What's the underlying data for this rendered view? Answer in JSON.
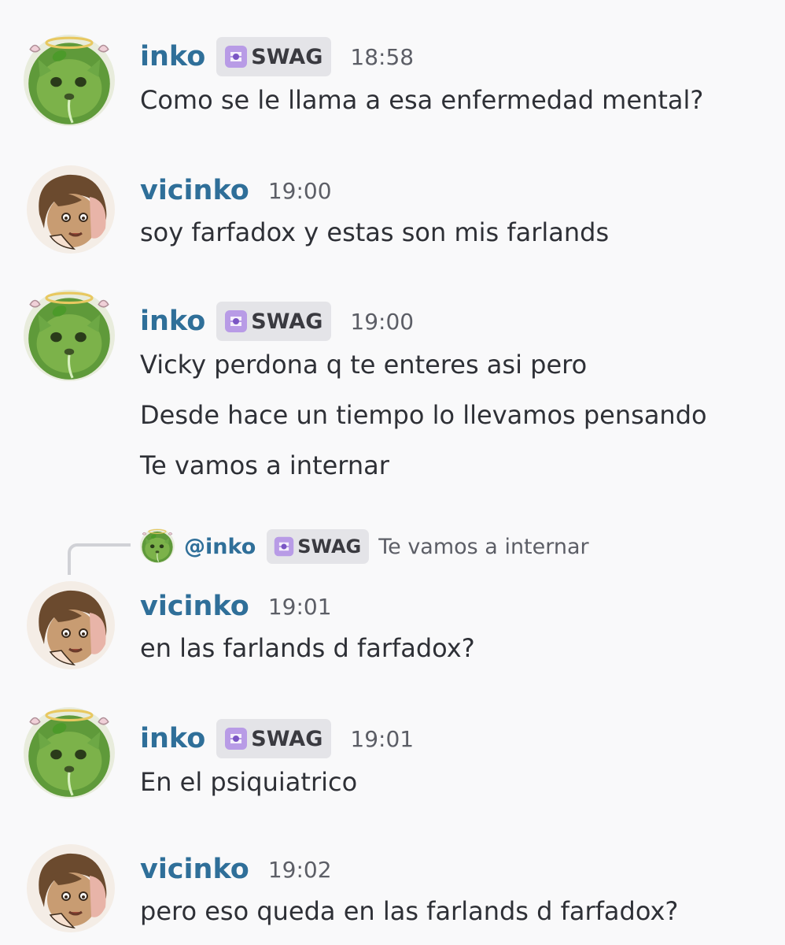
{
  "colors": {
    "background": "#f9f9fa",
    "username": "#2f6f99",
    "tag_bg": "#e4e4e8",
    "tag_icon": "#9b74d4",
    "text": "#2e3036",
    "timestamp": "#5c5e66"
  },
  "messages": [
    {
      "author": "inko",
      "avatar_icon": "green-cat-halo-avatar",
      "tag": "SWAG",
      "tag_icon": "swag-tag-icon",
      "time": "18:58",
      "lines": [
        "Como se le llama a esa enfermedad mental?"
      ]
    },
    {
      "author": "vicinko",
      "avatar_icon": "drawn-character-avatar",
      "time": "19:00",
      "lines": [
        "soy farfadox y estas son mis farlands"
      ]
    },
    {
      "author": "inko",
      "avatar_icon": "green-cat-halo-avatar",
      "tag": "SWAG",
      "tag_icon": "swag-tag-icon",
      "time": "19:00",
      "lines": [
        "Vicky perdona q te enteres asi pero",
        "Desde hace un tiempo lo llevamos pensando",
        "Te vamos a internar"
      ]
    },
    {
      "author": "vicinko",
      "avatar_icon": "drawn-character-avatar",
      "time": "19:01",
      "reply": {
        "mention": "@inko",
        "tag": "SWAG",
        "text": "Te vamos a internar"
      },
      "lines": [
        "en las farlands d farfadox?"
      ]
    },
    {
      "author": "inko",
      "avatar_icon": "green-cat-halo-avatar",
      "tag": "SWAG",
      "tag_icon": "swag-tag-icon",
      "time": "19:01",
      "lines": [
        "En el psiquiatrico"
      ]
    },
    {
      "author": "vicinko",
      "avatar_icon": "drawn-character-avatar",
      "time": "19:02",
      "lines": [
        "pero eso queda en las farlands d farfadox?"
      ]
    }
  ]
}
